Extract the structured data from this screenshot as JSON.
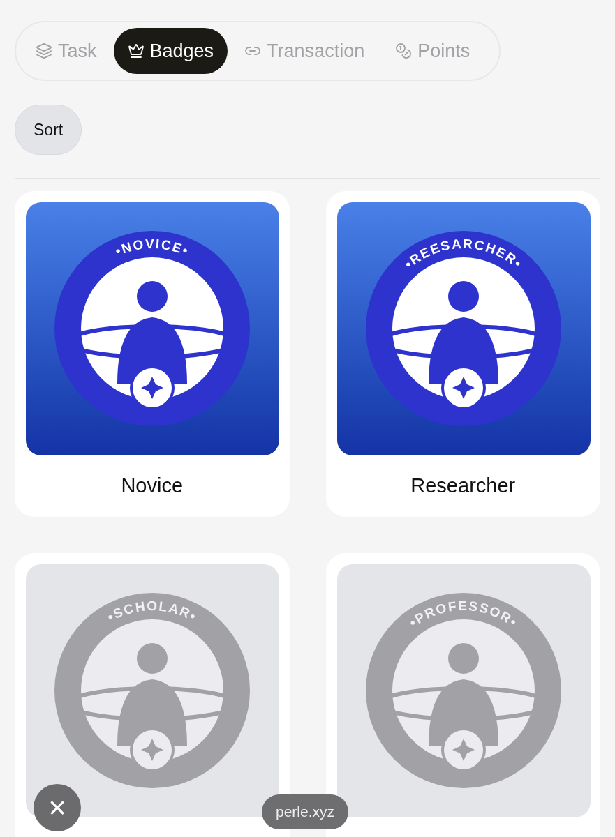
{
  "tabs": [
    {
      "label": "Task",
      "selected": false
    },
    {
      "label": "Badges",
      "selected": true
    },
    {
      "label": "Transaction",
      "selected": false
    },
    {
      "label": "Points",
      "selected": false
    }
  ],
  "sort_button": "Sort",
  "badges": [
    {
      "ring_text": "•NOVICE•",
      "label": "Novice",
      "earned": true
    },
    {
      "ring_text": "•REESARCHER•",
      "label": "Researcher",
      "earned": true
    },
    {
      "ring_text": "•SCHOLAR•",
      "earned": false
    },
    {
      "ring_text": "•PROFESSOR•",
      "earned": false
    }
  ],
  "overlay": {
    "close": "×",
    "site": "perle.xyz"
  }
}
